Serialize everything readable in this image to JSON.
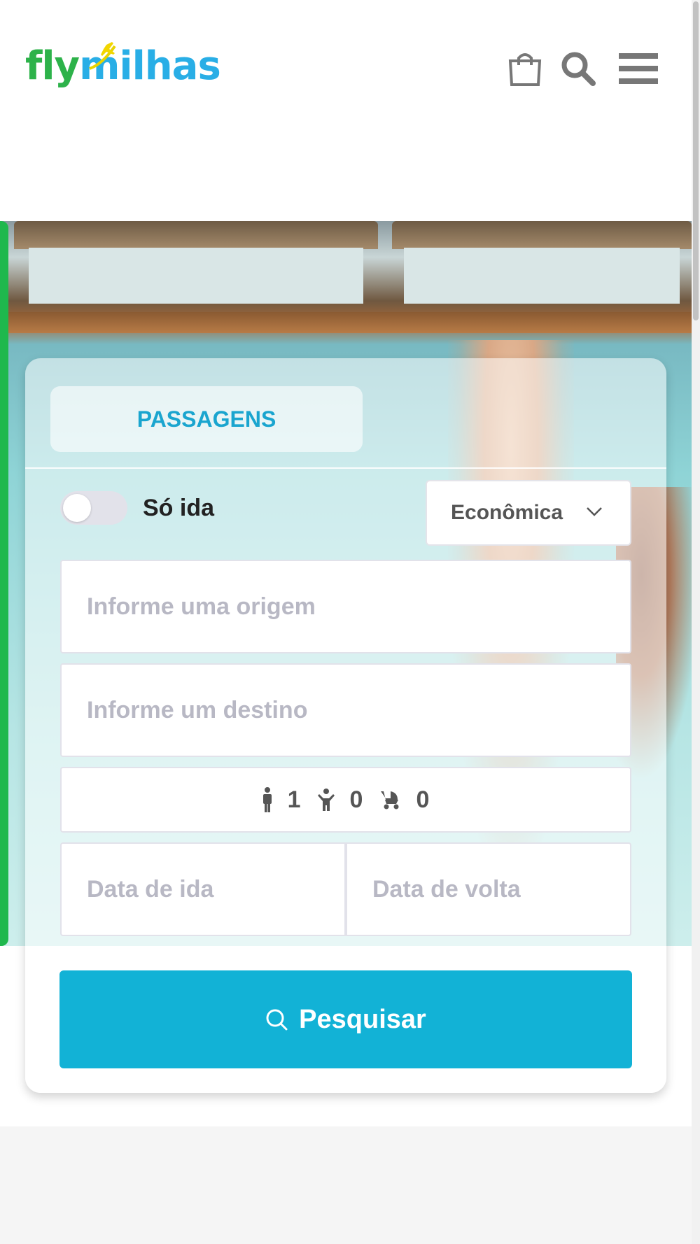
{
  "header": {
    "logo_part1": "fly",
    "logo_part2": "milhas",
    "icons": [
      "shopping-bag-icon",
      "search-icon",
      "hamburger-menu-icon"
    ]
  },
  "search_form": {
    "tab_label": "PASSAGENS",
    "one_way_label": "Só ida",
    "one_way_enabled": false,
    "cabin_class": "Econômica",
    "origin_placeholder": "Informe uma origem",
    "destination_placeholder": "Informe um destino",
    "passengers": {
      "adults": "1",
      "children": "0",
      "infants": "0"
    },
    "departure_placeholder": "Data de ida",
    "return_placeholder": "Data de volta",
    "search_button_label": "Pesquisar"
  },
  "colors": {
    "logo_green": "#2db24a",
    "logo_blue": "#29aee6",
    "accent": "#12b2d6",
    "tab_text": "#1aa5cf"
  }
}
